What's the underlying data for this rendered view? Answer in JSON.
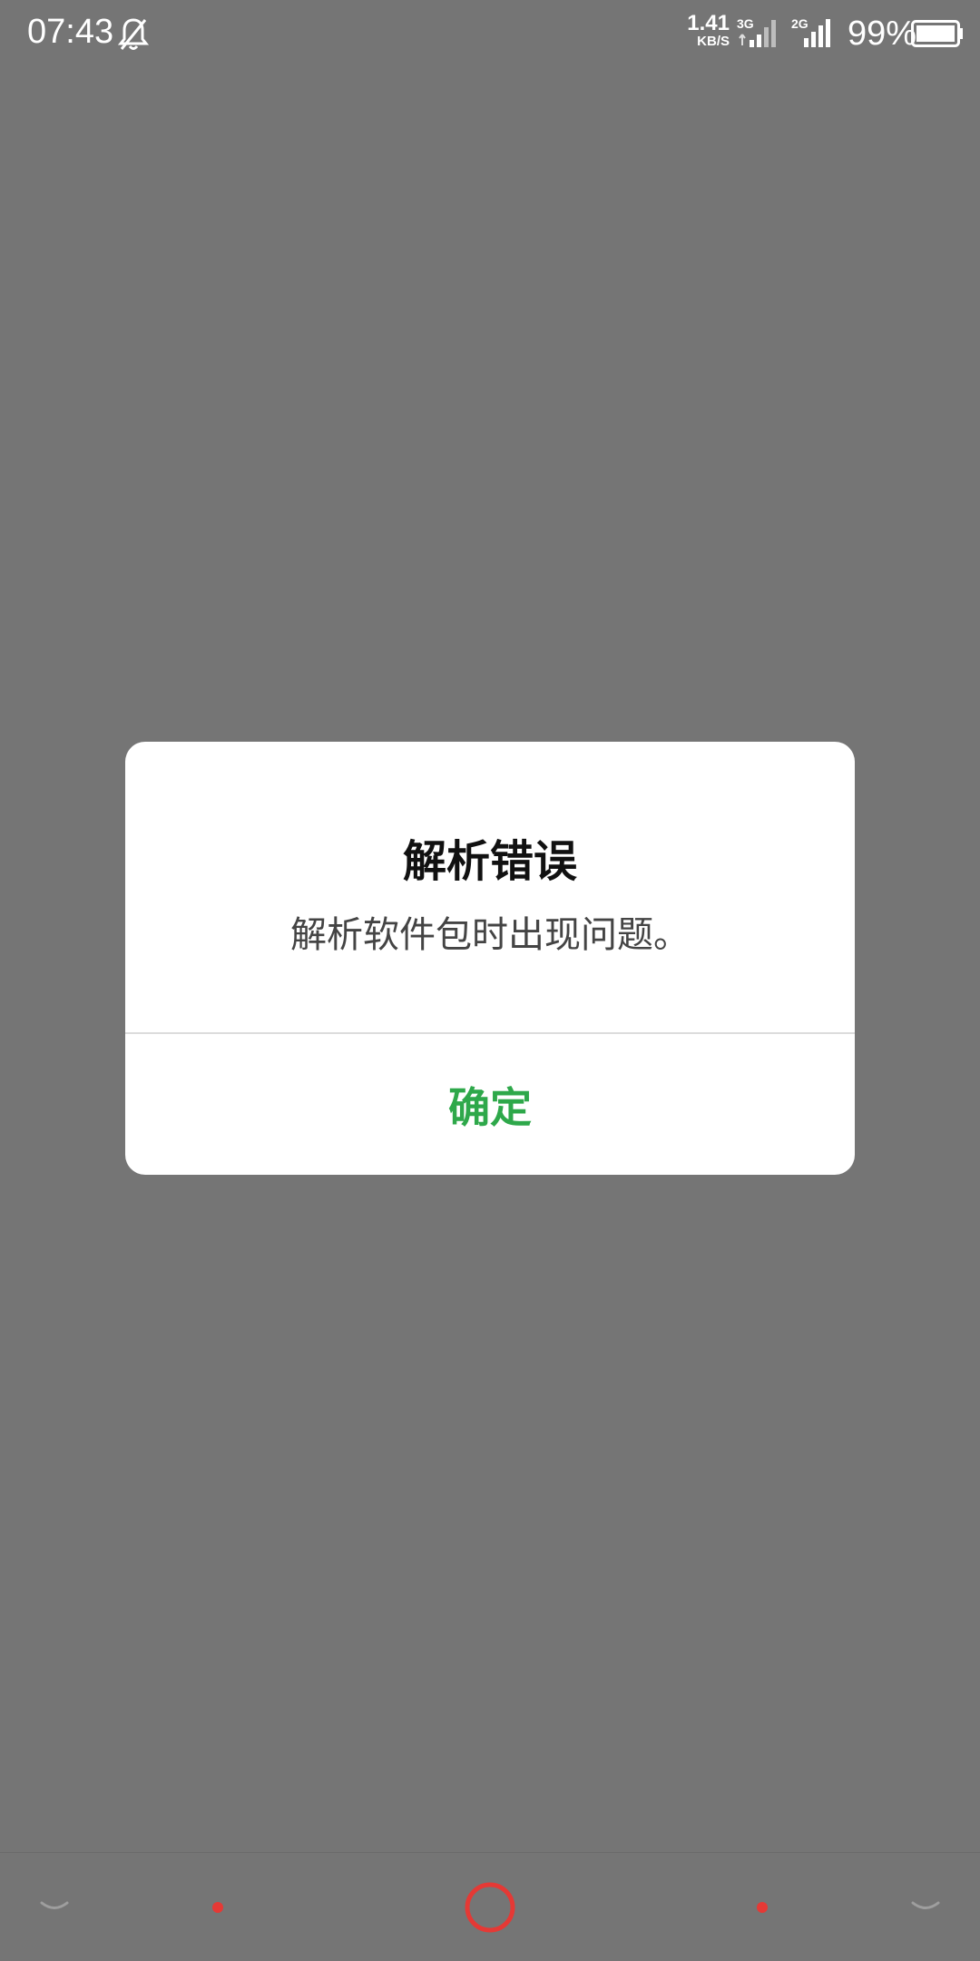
{
  "status_bar": {
    "time": "07:43",
    "net_speed_value": "1.41",
    "net_speed_unit": "KB/S",
    "sim1_label": "3G",
    "sim2_label": "2G",
    "battery_percent": "99%"
  },
  "dialog": {
    "title": "解析错误",
    "message": "解析软件包时出现问题。",
    "confirm_label": "确定"
  },
  "colors": {
    "scrim": "#757575",
    "dialog_bg": "#ffffff",
    "confirm_text": "#2ea84a",
    "nav_accent": "#e53935"
  },
  "icons": {
    "status": [
      "bell-off-icon",
      "signal-icon",
      "battery-icon"
    ],
    "nav": [
      "chevron-down-icon",
      "dot-icon",
      "home-ring-icon",
      "dot-icon",
      "chevron-down-icon"
    ]
  }
}
